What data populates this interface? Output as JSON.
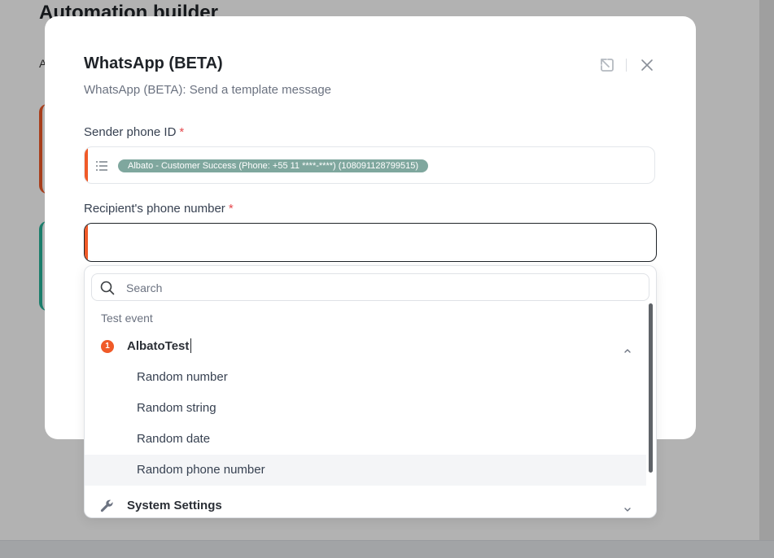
{
  "background": {
    "page_title": "Automation builder",
    "partial_letter": "A"
  },
  "modal": {
    "title": "WhatsApp (BETA)",
    "subtitle": "WhatsApp (BETA): Send a template message",
    "icons": {
      "open_external": "open-in-new-icon",
      "close": "close-icon"
    },
    "sender": {
      "label": "Sender phone ID",
      "required_mark": "*",
      "value_chip": "Albato - Customer Success (Phone: +55 11 ****-****) (108091128799515)"
    },
    "recipient": {
      "label": "Recipient's phone number",
      "required_mark": "*",
      "value": ""
    }
  },
  "dropdown": {
    "search_placeholder": "Search",
    "section_label": "Test event",
    "groups": [
      {
        "badge": "1",
        "name": "AlbatoTest",
        "expanded": true,
        "items": [
          "Random number",
          "Random string",
          "Random date",
          "Random phone number"
        ]
      },
      {
        "icon": "wrench-icon",
        "name": "System Settings",
        "expanded": false
      }
    ],
    "highlighted_item_index": 3
  },
  "colors": {
    "accent_orange": "#f05a28",
    "accent_teal": "#28b49a",
    "chip_bg": "#7fa79e",
    "required_red": "#e5484d"
  }
}
